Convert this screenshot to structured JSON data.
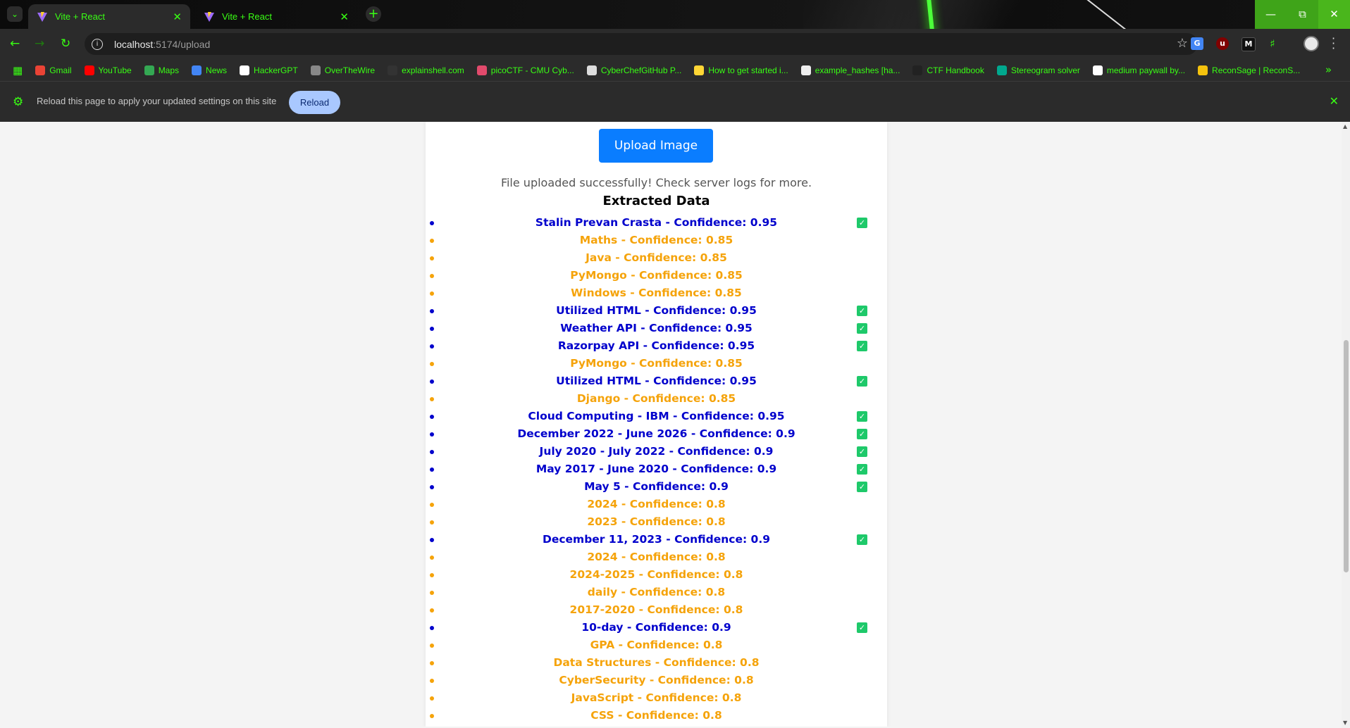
{
  "browser": {
    "tabs": [
      {
        "title": "Vite + React",
        "active": true
      },
      {
        "title": "Vite + React",
        "active": false
      }
    ],
    "url_host": "localhost",
    "url_path": ":5174/upload",
    "bookmarks": [
      {
        "label": "Gmail",
        "icon": "gmail-icon",
        "color": "#ea4335"
      },
      {
        "label": "YouTube",
        "icon": "youtube-icon",
        "color": "#ff0000"
      },
      {
        "label": "Maps",
        "icon": "maps-icon",
        "color": "#34a853"
      },
      {
        "label": "News",
        "icon": "news-icon",
        "color": "#4285f4"
      },
      {
        "label": "HackerGPT",
        "icon": "hackergpt-icon",
        "color": "#ffffff"
      },
      {
        "label": "OverTheWire",
        "icon": "overthewire-icon",
        "color": "#888888"
      },
      {
        "label": "explainshell.com",
        "icon": "explainshell-icon",
        "color": "#333333"
      },
      {
        "label": "picoCTF - CMU Cyb...",
        "icon": "picoctf-icon",
        "color": "#e24a6c"
      },
      {
        "label": "CyberChefGitHub P...",
        "icon": "cyberchef-icon",
        "color": "#dddddd"
      },
      {
        "label": "How to get started i...",
        "icon": "reddit-icon",
        "color": "#ffd635"
      },
      {
        "label": "example_hashes [ha...",
        "icon": "hashcat-icon",
        "color": "#eeeeee"
      },
      {
        "label": "CTF Handbook",
        "icon": "ctf-handbook-icon",
        "color": "#222222"
      },
      {
        "label": "Stereogram solver",
        "icon": "stereogram-icon",
        "color": "#00a88e"
      },
      {
        "label": "medium paywall by...",
        "icon": "medium-icon",
        "color": "#ffffff"
      },
      {
        "label": "ReconSage | ReconS...",
        "icon": "reconsage-icon",
        "color": "#f4c20d"
      }
    ],
    "infobar_message": "Reload this page to apply your updated settings on this site",
    "infobar_button": "Reload"
  },
  "page": {
    "upload_label": "Upload Image",
    "status": "File uploaded successfully! Check server logs for more.",
    "heading": "Extracted Data",
    "colors": {
      "high": "#0000cc",
      "low": "#f5a30a",
      "check": "#1ec96a",
      "button": "#0a7dff"
    },
    "items": [
      {
        "text": "Stalin Prevan Crasta - Confidence: 0.95",
        "checked": true
      },
      {
        "text": "Maths - Confidence: 0.85",
        "checked": false
      },
      {
        "text": "Java - Confidence: 0.85",
        "checked": false
      },
      {
        "text": "PyMongo - Confidence: 0.85",
        "checked": false
      },
      {
        "text": "Windows - Confidence: 0.85",
        "checked": false
      },
      {
        "text": "Utilized HTML - Confidence: 0.95",
        "checked": true
      },
      {
        "text": "Weather API - Confidence: 0.95",
        "checked": true
      },
      {
        "text": "Razorpay API - Confidence: 0.95",
        "checked": true
      },
      {
        "text": "PyMongo - Confidence: 0.85",
        "checked": false
      },
      {
        "text": "Utilized HTML - Confidence: 0.95",
        "checked": true
      },
      {
        "text": "Django - Confidence: 0.85",
        "checked": false
      },
      {
        "text": "Cloud Computing - IBM - Confidence: 0.95",
        "checked": true
      },
      {
        "text": "December 2022 - June 2026 - Confidence: 0.9",
        "checked": true
      },
      {
        "text": "July 2020 - July 2022 - Confidence: 0.9",
        "checked": true
      },
      {
        "text": "May 2017 - June 2020 - Confidence: 0.9",
        "checked": true
      },
      {
        "text": "May 5 - Confidence: 0.9",
        "checked": true
      },
      {
        "text": "2024 - Confidence: 0.8",
        "checked": false
      },
      {
        "text": "2023 - Confidence: 0.8",
        "checked": false
      },
      {
        "text": "December 11, 2023 - Confidence: 0.9",
        "checked": true
      },
      {
        "text": "2024 - Confidence: 0.8",
        "checked": false
      },
      {
        "text": "2024-2025 - Confidence: 0.8",
        "checked": false
      },
      {
        "text": "daily - Confidence: 0.8",
        "checked": false
      },
      {
        "text": "2017-2020 - Confidence: 0.8",
        "checked": false
      },
      {
        "text": "10-day - Confidence: 0.9",
        "checked": true
      },
      {
        "text": "GPA - Confidence: 0.8",
        "checked": false
      },
      {
        "text": "Data Structures - Confidence: 0.8",
        "checked": false
      },
      {
        "text": "CyberSecurity - Confidence: 0.8",
        "checked": false
      },
      {
        "text": "JavaScript - Confidence: 0.8",
        "checked": false
      },
      {
        "text": "CSS - Confidence: 0.8",
        "checked": false
      }
    ]
  }
}
